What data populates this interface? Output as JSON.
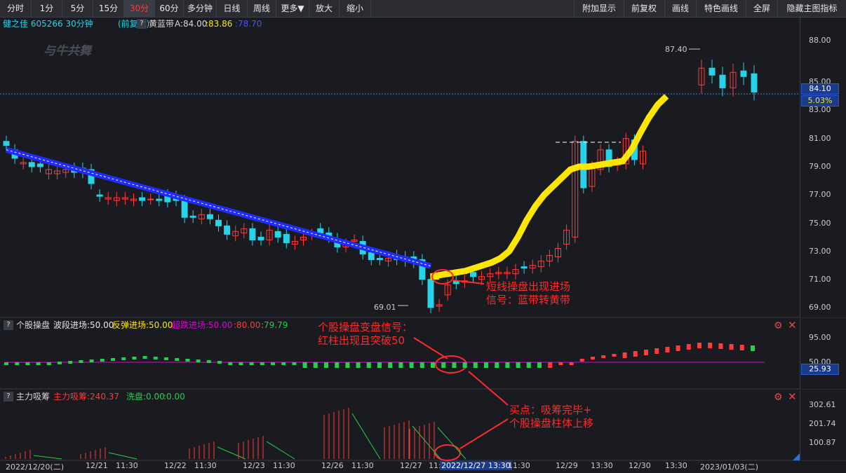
{
  "toolbar": {
    "left": [
      "分时",
      "1分",
      "5分",
      "15分",
      "30分",
      "60分",
      "多分钟",
      "日线",
      "周线",
      "更多▼",
      "放大",
      "缩小"
    ],
    "active_index": 4,
    "right": [
      "附加显示",
      "前复权",
      "画线",
      "特色画线",
      "全屏",
      "隐藏主图指标"
    ]
  },
  "main": {
    "stock": "健之佳 605266 30分钟",
    "fq": "(前复权)",
    "help": "?",
    "indicator": "黄蓝带",
    "a_label": "A:84.00",
    "v2": ":83.86",
    "v3": ":78.70",
    "watermark": "与牛共舞",
    "price_axis": [
      "88.00",
      "85.00",
      "83.00",
      "81.00",
      "79.00",
      "77.00",
      "75.00",
      "73.00",
      "71.00",
      "69.00"
    ],
    "current_price": "84.10",
    "current_pct": "5.03%",
    "high_label": "87.40",
    "low_label": "69.01",
    "annotation_line1": "短线操盘出现进场",
    "annotation_line2": "信号：蓝带转黄带"
  },
  "mid": {
    "help": "?",
    "name": "个股操盘",
    "l1": "波段进场:50.00",
    "l2": "反弹进场:50.00",
    "l3": "超跌进场:50.00",
    "l4": ":80.00",
    "l5": ":79.79",
    "axis": [
      "95.00",
      "50.00"
    ],
    "current": "25.93",
    "annotation_line1": "个股操盘变盘信号：",
    "annotation_line2": "红柱出现且突破50"
  },
  "bottom": {
    "help": "?",
    "name": "主力吸筹",
    "l1": "主力吸筹",
    "l2": ":240.37",
    "l3": "洗盘:0.00",
    "l4": ":0.00",
    "axis": [
      "302.61",
      "201.74",
      "100.87"
    ],
    "annotation_line1": "买点：吸筹完毕+",
    "annotation_line2": "个股操盘柱体上移"
  },
  "time_axis": [
    "2022/12/20(二)",
    "12/21",
    "11:30",
    "12/22",
    "11:30",
    "12/23",
    "11:30",
    "12/26",
    "11:30",
    "12/27",
    "11:30",
    "2022/12/27 13:30",
    "11:30",
    "12/29",
    "13:30",
    "12/30",
    "13:30",
    "2023/01/03(二)"
  ],
  "colors": {
    "up": "#ff3b3b",
    "down": "#27d3e8",
    "yellow": "#ffe600",
    "blue": "#1f2bff",
    "magenta": "#e000e0",
    "green": "#22d14a"
  }
}
